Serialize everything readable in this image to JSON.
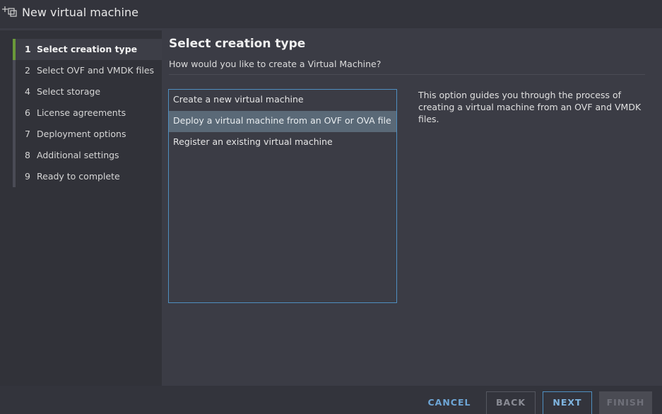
{
  "titlebar": {
    "title": "New virtual machine",
    "icon": "add-vm-icon"
  },
  "sidebar": {
    "steps": [
      {
        "number": "1",
        "label": "Select creation type",
        "active": true
      },
      {
        "number": "2",
        "label": "Select OVF and VMDK files",
        "active": false
      },
      {
        "number": "4",
        "label": "Select storage",
        "active": false
      },
      {
        "number": "6",
        "label": "License agreements",
        "active": false
      },
      {
        "number": "7",
        "label": "Deployment options",
        "active": false
      },
      {
        "number": "8",
        "label": "Additional settings",
        "active": false
      },
      {
        "number": "9",
        "label": "Ready to complete",
        "active": false
      }
    ]
  },
  "main": {
    "heading": "Select creation type",
    "subheading": "How would you like to create a Virtual Machine?",
    "options": [
      {
        "label": "Create a new virtual machine",
        "selected": false
      },
      {
        "label": "Deploy a virtual machine from an OVF or OVA file",
        "selected": true
      },
      {
        "label": "Register an existing virtual machine",
        "selected": false
      }
    ],
    "description": "This option guides you through the process of creating a virtual machine from an OVF and VMDK files."
  },
  "footer": {
    "cancel_label": "CANCEL",
    "back_label": "BACK",
    "next_label": "NEXT",
    "finish_label": "FINISH"
  },
  "colors": {
    "accent": "#4f8fc0",
    "active_step_marker": "#6a9a3a",
    "selected_option": "#5a6977"
  }
}
